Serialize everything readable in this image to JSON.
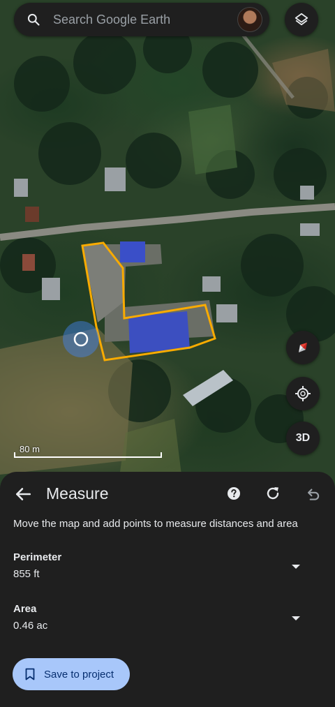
{
  "search": {
    "placeholder": "Search Google Earth",
    "icon": "search-icon"
  },
  "map": {
    "scale_label": "80 m",
    "controls": {
      "layers_icon": "layers-icon",
      "compass_icon": "compass-icon",
      "location_icon": "my-location-icon",
      "three_d_label": "3D"
    },
    "outline_color": "#f9ab00",
    "location_color": "#4285f4"
  },
  "measure": {
    "title": "Measure",
    "instruction": "Move the map and add points to measure distances and area",
    "metrics": [
      {
        "label": "Perimeter",
        "value": "855 ft"
      },
      {
        "label": "Area",
        "value": "0.46 ac"
      }
    ],
    "save_label": "Save to project",
    "accent": "#a8c7fa"
  }
}
